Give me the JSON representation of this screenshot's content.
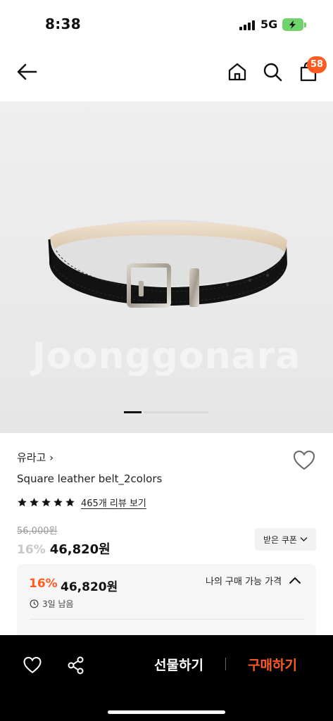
{
  "status_bar": {
    "time": "8:38",
    "network": "5G"
  },
  "nav": {
    "cart_count": "58"
  },
  "product_image": {
    "watermark": "Joonggonara"
  },
  "product": {
    "brand": "유라고 ›",
    "title": "Square leather belt_2colors",
    "rating_stars": 5,
    "review_link": "465개 리뷰 보기",
    "original_price": "56,000원",
    "discount": "16%",
    "sale_price": "46,820원",
    "coupon_button": "받은 쿠폰"
  },
  "my_price": {
    "discount": "16%",
    "price": "46,820원",
    "timer": "3일 남음",
    "toggle_label": "나의 구매 가능 가격"
  },
  "bottom_bar": {
    "gift_label": "선물하기",
    "buy_label": "구매하기"
  },
  "colors": {
    "accent": "#ff5a1f",
    "battery": "#6ed36a"
  }
}
